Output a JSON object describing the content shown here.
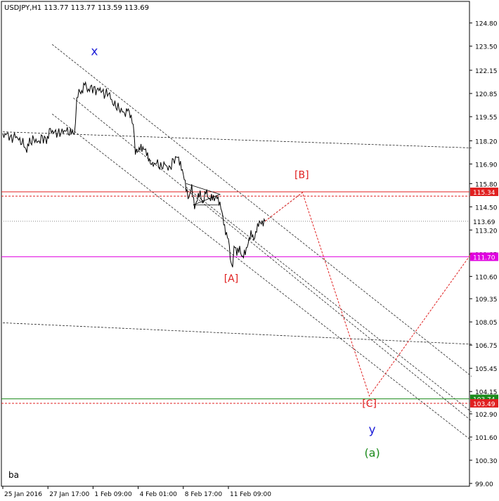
{
  "chart_data": {
    "type": "line",
    "title": "USDJPY,H1  113.77 113.77 113.59 113.69",
    "symbol_label": "ba",
    "ylim": [
      99.0,
      125.3
    ],
    "y_ticks": [
      "124.80",
      "123.50",
      "122.15",
      "120.85",
      "119.55",
      "118.20",
      "116.90",
      "115.80",
      "114.50",
      "113.20",
      "111.85",
      "110.60",
      "109.35",
      "108.05",
      "106.75",
      "105.45",
      "104.15",
      "102.90",
      "101.60",
      "100.30",
      "99.00"
    ],
    "y_tick_values": [
      124.8,
      123.5,
      122.15,
      120.85,
      119.55,
      118.2,
      116.9,
      115.8,
      114.5,
      113.2,
      111.85,
      110.6,
      109.35,
      108.05,
      106.75,
      105.45,
      104.15,
      102.9,
      101.6,
      100.3,
      99.0
    ],
    "x_ticks": [
      "25 Jan 2016",
      "27 Jan 17:00",
      "1 Feb 09:00",
      "4 Feb 01:00",
      "8 Feb 17:00",
      "11 Feb 09:00"
    ],
    "x_tick_bars": [
      0,
      64,
      128,
      192,
      256,
      320
    ],
    "bar_range": [
      0,
      660
    ],
    "price": [
      [
        0,
        118.5
      ],
      [
        6,
        118.6
      ],
      [
        12,
        118.3
      ],
      [
        18,
        118.5
      ],
      [
        24,
        118.2
      ],
      [
        30,
        118.0
      ],
      [
        34,
        117.7
      ],
      [
        38,
        118.1
      ],
      [
        44,
        118.3
      ],
      [
        50,
        118.1
      ],
      [
        56,
        118.4
      ],
      [
        62,
        118.2
      ],
      [
        66,
        118.8
      ],
      [
        72,
        118.7
      ],
      [
        78,
        118.6
      ],
      [
        84,
        118.7
      ],
      [
        90,
        118.8
      ],
      [
        96,
        118.6
      ],
      [
        100,
        118.7
      ],
      [
        103,
        118.9
      ],
      [
        105,
        120.6
      ],
      [
        108,
        120.9
      ],
      [
        112,
        121.0
      ],
      [
        116,
        121.4
      ],
      [
        120,
        121.0
      ],
      [
        126,
        121.2
      ],
      [
        132,
        121.0
      ],
      [
        138,
        121.1
      ],
      [
        144,
        120.8
      ],
      [
        150,
        120.9
      ],
      [
        156,
        120.3
      ],
      [
        162,
        120.1
      ],
      [
        168,
        119.9
      ],
      [
        174,
        119.7
      ],
      [
        178,
        119.9
      ],
      [
        182,
        119.6
      ],
      [
        185,
        119.0
      ],
      [
        188,
        117.7
      ],
      [
        192,
        117.5
      ],
      [
        196,
        117.9
      ],
      [
        200,
        117.8
      ],
      [
        204,
        117.4
      ],
      [
        208,
        117.2
      ],
      [
        212,
        116.8
      ],
      [
        218,
        117.0
      ],
      [
        224,
        116.7
      ],
      [
        230,
        116.9
      ],
      [
        236,
        116.6
      ],
      [
        242,
        117.1
      ],
      [
        248,
        117.3
      ],
      [
        252,
        117.0
      ],
      [
        256,
        116.2
      ],
      [
        260,
        115.6
      ],
      [
        264,
        115.0
      ],
      [
        268,
        115.5
      ],
      [
        272,
        114.6
      ],
      [
        276,
        114.9
      ],
      [
        280,
        115.2
      ],
      [
        284,
        114.8
      ],
      [
        288,
        115.3
      ],
      [
        292,
        115.0
      ],
      [
        296,
        115.1
      ],
      [
        300,
        114.8
      ],
      [
        304,
        115.2
      ],
      [
        308,
        114.6
      ],
      [
        312,
        113.9
      ],
      [
        316,
        113.2
      ],
      [
        320,
        112.6
      ],
      [
        324,
        111.2
      ],
      [
        326,
        110.9
      ],
      [
        328,
        112.4
      ],
      [
        332,
        111.8
      ],
      [
        336,
        112.3
      ],
      [
        340,
        111.6
      ],
      [
        344,
        111.9
      ],
      [
        348,
        112.6
      ],
      [
        352,
        112.9
      ],
      [
        356,
        112.7
      ],
      [
        360,
        113.3
      ],
      [
        364,
        113.5
      ],
      [
        368,
        113.7
      ],
      [
        372,
        113.69
      ]
    ],
    "red_wave_projection": [
      [
        372,
        113.69
      ],
      [
        425,
        115.3
      ],
      [
        520,
        103.9
      ],
      [
        665,
        111.9
      ]
    ],
    "gray_wave_projection": [
      [
        372,
        113.69
      ],
      [
        425,
        115.3
      ]
    ],
    "h_lines": [
      {
        "price": 115.34,
        "label": "115.34",
        "color": "#e02020"
      },
      {
        "price": 115.1,
        "label": "",
        "color": "#e02020"
      },
      {
        "price": 113.69,
        "label": "113.69",
        "color": "#888888"
      },
      {
        "price": 111.7,
        "label": "111.70",
        "color": "#e000e0"
      },
      {
        "price": 103.74,
        "label": "103.74",
        "color": "#1a8a1a"
      },
      {
        "price": 103.49,
        "label": "103.49",
        "color": "#e02020"
      }
    ],
    "trend_lines": [
      [
        [
          0,
          118.7
        ],
        [
          665,
          117.8
        ]
      ],
      [
        [
          0,
          108.0
        ],
        [
          665,
          106.8
        ]
      ],
      [
        [
          70,
          123.6
        ],
        [
          665,
          105.0
        ]
      ],
      [
        [
          100,
          120.6
        ],
        [
          665,
          102.5
        ]
      ],
      [
        [
          70,
          119.7
        ],
        [
          665,
          101.4
        ]
      ],
      [
        [
          260,
          115.6
        ],
        [
          665,
          103.0
        ]
      ]
    ],
    "triangle": [
      [
        260,
        115.8
      ],
      [
        308,
        115.2
      ],
      [
        270,
        114.6
      ],
      [
        306,
        114.6
      ]
    ],
    "annotations": [
      {
        "text": "x",
        "bar": 130,
        "price": 123.0,
        "color": "#1f20d8",
        "size": 17
      },
      {
        "text": "[B]",
        "bar": 424,
        "price": 116.1,
        "color": "#e02020",
        "size": 14
      },
      {
        "text": "[A]",
        "bar": 324,
        "price": 110.3,
        "color": "#e02020",
        "size": 14
      },
      {
        "text": "[C]",
        "bar": 520,
        "price": 103.3,
        "color": "#e02020",
        "size": 14
      },
      {
        "text": "y",
        "bar": 524,
        "price": 101.8,
        "color": "#1f20d8",
        "size": 17
      },
      {
        "text": "(a)",
        "bar": 524,
        "price": 100.5,
        "color": "#1a8a1a",
        "size": 16
      }
    ]
  }
}
